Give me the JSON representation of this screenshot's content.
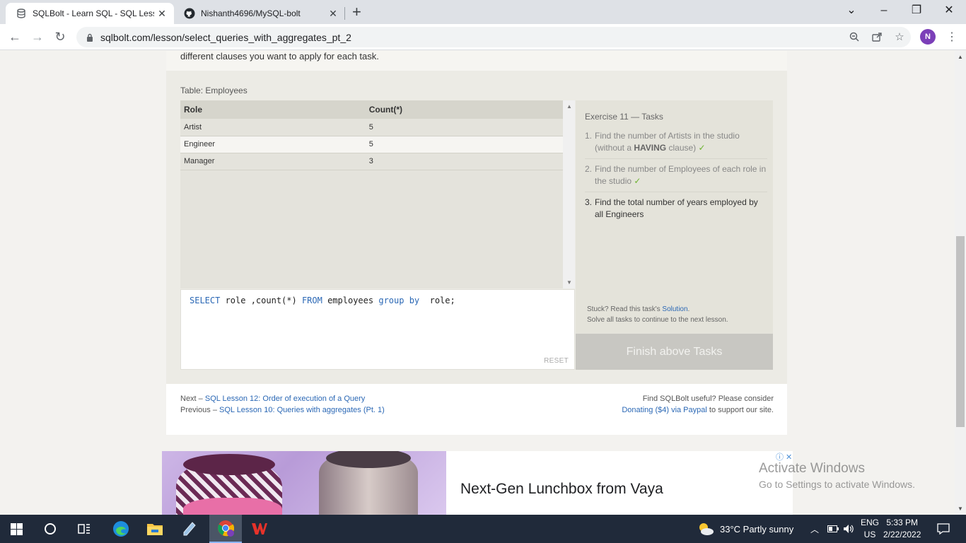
{
  "browser": {
    "tabs": [
      {
        "title": "SQLBolt - Learn SQL - SQL Lesson"
      },
      {
        "title": "Nishanth4696/MySQL-bolt"
      }
    ],
    "url": "sqlbolt.com/lesson/select_queries_with_aggregates_pt_2",
    "profile_initial": "N",
    "icons": {
      "back": "arrow-left-icon",
      "forward": "arrow-right-icon",
      "reload": "reload-icon",
      "zoom": "zoom-icon",
      "share": "share-icon",
      "bookmark": "star-icon",
      "menu": "kebab-icon"
    }
  },
  "page": {
    "intro_text": "different clauses you want to apply for each task.",
    "table_label": "Table: Employees",
    "results": {
      "headers": [
        "Role",
        "Count(*)"
      ],
      "rows": [
        [
          "Artist",
          "5"
        ],
        [
          "Engineer",
          "5"
        ],
        [
          "Manager",
          "3"
        ]
      ]
    },
    "editor": {
      "tokens": [
        "SELECT",
        " role ,count(*) ",
        "FROM",
        " employees ",
        "group by",
        "  role;"
      ],
      "reset_label": "RESET"
    },
    "tasks": {
      "title": "Exercise 11 — Tasks",
      "items": [
        {
          "num": "1.",
          "text_a": "Find the number of Artists in the studio (without a ",
          "strong": "HAVING",
          "text_b": " clause)",
          "check": "✓"
        },
        {
          "num": "2.",
          "text": "Find the number of Employees of each role in the studio",
          "check": "✓"
        },
        {
          "num": "3.",
          "text": "Find the total number of years employed by all Engineers"
        }
      ],
      "stuck_text": "Stuck? Read this task's ",
      "solution_link": "Solution",
      "stuck_end": ".",
      "continue_text": "Solve all tasks to continue to the next lesson.",
      "finish_label": "Finish above Tasks"
    },
    "footer": {
      "next_prefix": "Next – ",
      "next_link": "SQL Lesson 12: Order of execution of a Query",
      "prev_prefix": "Previous – ",
      "prev_link": "SQL Lesson 10: Queries with aggregates (Pt. 1)",
      "donate_line1": "Find SQLBolt useful? Please consider",
      "donate_link": "Donating ($4) via Paypal",
      "donate_end": " to support our site."
    },
    "ad": {
      "title": "Next-Gen Lunchbox from Vaya",
      "badge": "ⓘ ✕"
    },
    "watermark": {
      "line1": "Activate Windows",
      "line2": "Go to Settings to activate Windows."
    }
  },
  "taskbar": {
    "weather": "33°C  Partly sunny",
    "lang_top": "ENG",
    "lang_bottom": "US",
    "time": "5:33 PM",
    "date": "2/22/2022"
  }
}
